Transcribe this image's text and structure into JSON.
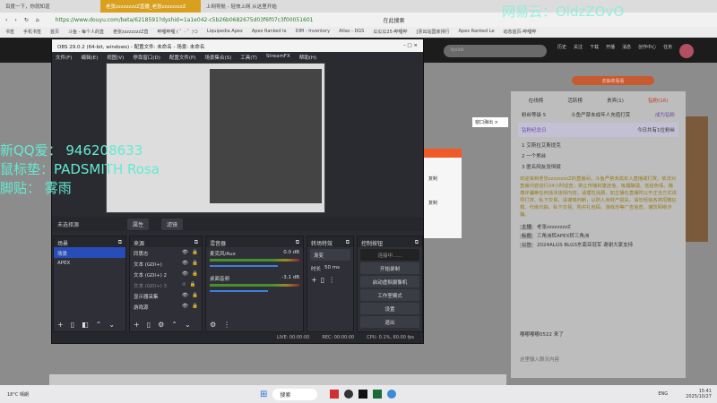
{
  "browser": {
    "tabs": [
      "百度一下，你就知道",
      "老张zzzzzzzzZ直播_老张zzzzzzzzZ",
      "上网导航 - 轻快上网 从这里开始"
    ],
    "url": "https://www.douyu.com/beta/6218591?dyshid=1a1e042-c5b26b0682675d03f6f07c3f00051601",
    "search_placeholder": "在此搜索",
    "bookmarks": [
      "书签",
      "手机书签",
      "首页",
      "斗鱼 - 每个人的直",
      "老张zzzzzzzzZ直",
      "哔哩哔哩 ( ゜- ゜)つ",
      "Liquipedia Apex",
      "Apex Ranked le",
      "DIM - Inventory",
      "Atlas - DGS",
      "瓜瓜瓜25-哔哩哔",
      "[票出站国家排行",
      "Apex Ranked Le",
      "动态首页-哔哩哔"
    ]
  },
  "watermark": "网易云：OldzZOvO",
  "douyu": {
    "search_value": "fpslok",
    "header_icons": [
      "历史",
      "关注",
      "下载",
      "开播",
      "消息",
      "创作中心",
      "任务"
    ],
    "popup": "窗口弹出",
    "copy": "复制",
    "rank_tabs": [
      "在线榜",
      "活跃榜",
      "贵宾(1)",
      "钻粉(16)"
    ],
    "cta": "去抽奖看看",
    "fan_label": "粉丝等级 5",
    "fan_notice": "斗鱼严禁未成年人充值打赏",
    "fan_join": "成为钻粉",
    "anniv": "钻粉纪念日",
    "anniv_count": "今日共有1位粉丝",
    "fans": [
      {
        "rank": "1",
        "name": "艾斯拉艾斯提克"
      },
      {
        "rank": "2",
        "name": "一个熊丝"
      },
      {
        "rank": "3",
        "name": "匿名网友张恒斌"
      }
    ],
    "notice": "欢迎来到老张zzzzzzzzZ的直播间。斗鱼严禁未成年人直播或打赏。依法对直播内容进行24小时巡查，禁止传播封建迷信、吸烟酗酒、低俗色情、赌博诈骗等任何违法违规内容。请理性消费，如主播在直播时以不正当方式诱导打赏、私下交易，请谨慎判断，以防人身财产损失。请勿轻信各类招聘征婚、代练代抽、私下交易、购买礼包码、游戏币等广告信息，谨防网络诈骗。",
    "info": [
      {
        "k": "主播",
        "v": "老张zzzzzzzzZ"
      },
      {
        "k": "标题",
        "v": "三角洲转APEX转三角洲"
      },
      {
        "k": "公告",
        "v": "2024ALGS BLGS东南亚冠军 谢谢大家支持"
      }
    ],
    "chat_msg": "嘟嘟嘟嘟0522 来了",
    "chat_placeholder": "这里输入聊天内容"
  },
  "overlay": [
    "新QQ爱：  946208633",
    "鼠标垫：PADSMITH Rosa",
    "脚贴：   雾雨"
  ],
  "obs": {
    "title": "OBS 29.0.2 (64-bit, windows) - 配置文件: 未命名 - 场景: 未命名",
    "menu": [
      "文件(F)",
      "编辑(E)",
      "视图(V)",
      "停靠窗口(D)",
      "配置文件(P)",
      "场景集合(S)",
      "工具(T)",
      "StreamFX",
      "帮助(H)"
    ],
    "no_source": "未选择源",
    "props": "属性",
    "filters": "滤镜",
    "scenes_title": "场景",
    "scenes": [
      "场景",
      "APEX"
    ],
    "sources_title": "来源",
    "sources": [
      "同惠志",
      "文本 (GDI+)",
      "文本 (GDI+) 2",
      "文本 (GDI+) 3",
      "显示器采集",
      "游戏源"
    ],
    "mixer_title": "混音器",
    "mixer": [
      {
        "name": "麦克风/Aux",
        "db": "0.0 dB",
        "level": 0.92
      },
      {
        "name": "桌面音频",
        "db": "-3.1 dB",
        "level": 0.78
      }
    ],
    "transitions_title": "转场特效",
    "transition": "渐变",
    "duration_label": "时长",
    "duration": "50 ms",
    "controls_title": "控制按钮",
    "controls": [
      "连接中......",
      "开始录制",
      "启动虚拟摄像机",
      "工作室模式",
      "设置",
      "退出"
    ],
    "status": {
      "live": "LIVE: 00:00:00",
      "rec": "REC: 00:00:00",
      "cpu": "CPU: 0.1%, 60.00 fps"
    }
  },
  "taskbar": {
    "weather_temp": "18°C",
    "weather": "晴朗",
    "search": "搜索",
    "lang": "ENG",
    "time": "15:41",
    "date": "2025/10/27"
  }
}
